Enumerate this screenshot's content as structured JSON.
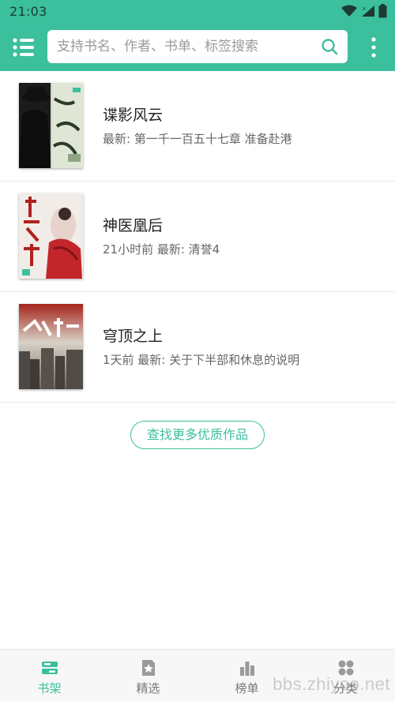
{
  "status_bar": {
    "time": "21:03"
  },
  "search": {
    "placeholder": "支持书名、作者、书单、标签搜索",
    "value": ""
  },
  "colors": {
    "accent": "#3bbf9c",
    "header": "#3bbf9c"
  },
  "books": [
    {
      "title": "谍影风云",
      "meta": "最新: 第一千一百五十七章 准备赴港"
    },
    {
      "title": "神医凰后",
      "meta": "21小时前 最新: 清誉4"
    },
    {
      "title": "穹顶之上",
      "meta": "1天前 最新: 关于下半部和休息的说明"
    }
  ],
  "find_more_label": "查找更多优质作品",
  "nav": [
    {
      "label": "书架",
      "icon": "bookshelf-icon",
      "active": true
    },
    {
      "label": "精选",
      "icon": "star-book-icon",
      "active": false
    },
    {
      "label": "榜单",
      "icon": "bar-chart-icon",
      "active": false
    },
    {
      "label": "分类",
      "icon": "category-icon",
      "active": false
    }
  ],
  "watermark": "bbs.zhiyoo.net"
}
